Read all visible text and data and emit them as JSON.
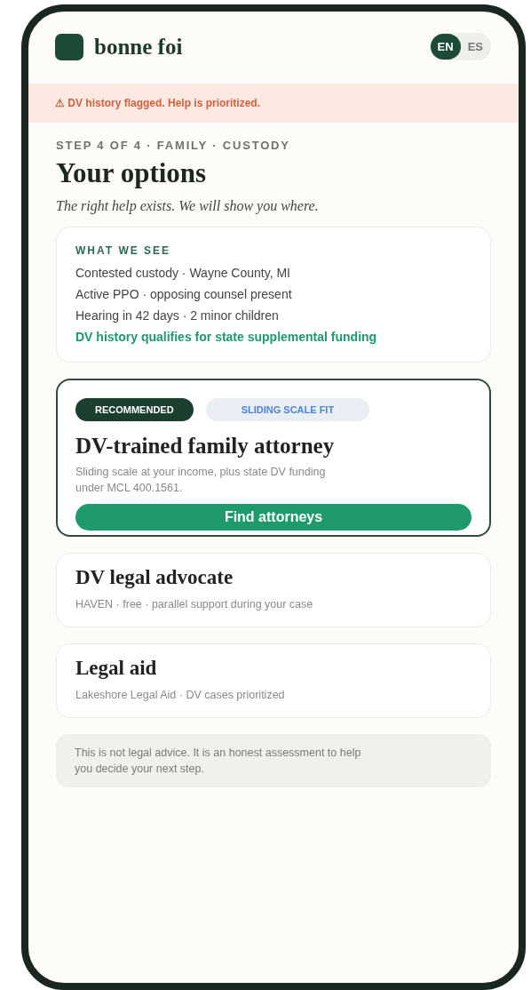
{
  "brand": {
    "name": "bonne foi"
  },
  "languages": [
    {
      "label": "EN",
      "selected": true
    },
    {
      "label": "ES",
      "selected": false
    }
  ],
  "alert": "⚠ DV history flagged. Help is prioritized.",
  "step": "STEP 4 OF 4 · FAMILY · CUSTODY",
  "title": "Your options",
  "subtitle": "The right help exists. We will show you where.",
  "summary": {
    "heading": "WHAT WE SEE",
    "lines": [
      {
        "text": "Contested custody · Wayne County, MI",
        "highlight": false
      },
      {
        "text": "Active PPO · opposing counsel present",
        "highlight": false
      },
      {
        "text": "Hearing in 42 days · 2 minor children",
        "highlight": false
      },
      {
        "text": "DV history qualifies for state supplemental funding",
        "highlight": true
      }
    ]
  },
  "options": [
    {
      "kind": "recommended",
      "badges": [
        {
          "label": "RECOMMENDED",
          "kind": "primary"
        },
        {
          "label": "SLIDING SCALE FIT",
          "kind": "info"
        }
      ],
      "title": "DV-trained family attorney",
      "description": "Sliding scale at your income, plus state DV funding under MCL 400.1561.",
      "action": "Find attorneys"
    },
    {
      "kind": "plain",
      "title": "DV legal advocate",
      "description": "HAVEN · free · parallel support during your case"
    },
    {
      "kind": "plain",
      "title": "Legal aid",
      "description": "Lakeshore Legal Aid · DV cases prioritized"
    }
  ],
  "disclaimer": "This is not legal advice. It is an honest assessment to help you decide your next step."
}
